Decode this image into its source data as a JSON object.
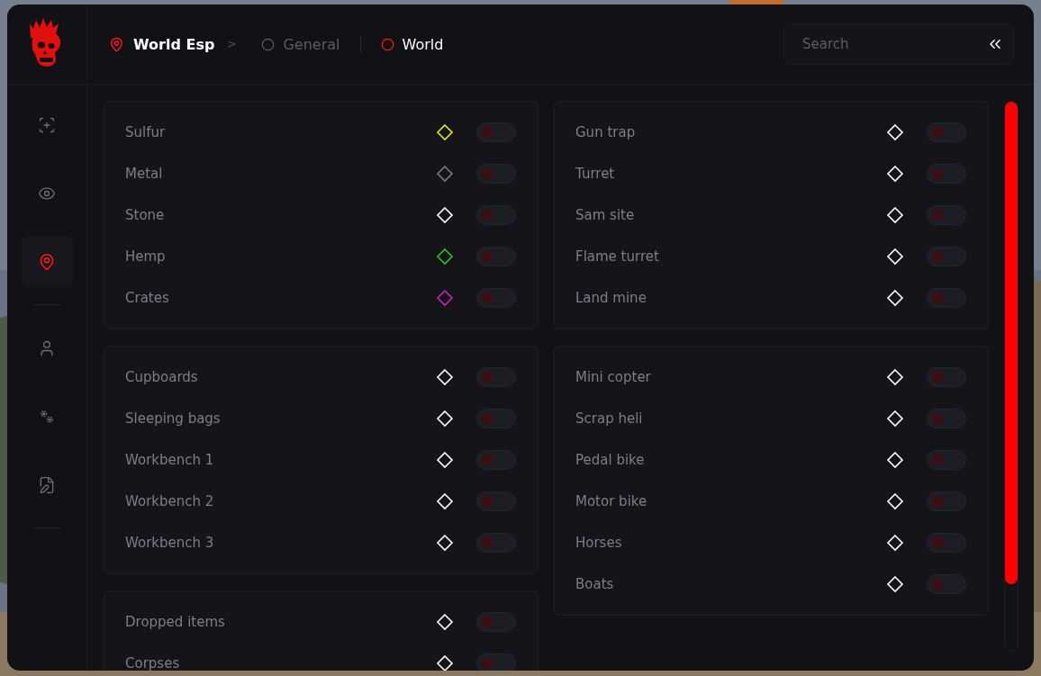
{
  "breadcrumb": {
    "section": "World Esp",
    "separator": ">"
  },
  "tabs": [
    {
      "label": "General",
      "selected": false
    },
    {
      "label": "World",
      "selected": true
    }
  ],
  "search": {
    "placeholder": "Search"
  },
  "sidebar": {
    "items": [
      {
        "selected": false
      },
      {
        "selected": false
      },
      {
        "selected": true
      },
      {
        "selected": false
      },
      {
        "selected": false
      },
      {
        "selected": false
      }
    ]
  },
  "columns": [
    [
      {
        "rows": [
          {
            "label": "Sulfur",
            "color": "#e6e620",
            "on": false
          },
          {
            "label": "Metal",
            "color": "#7a7a7e",
            "on": false
          },
          {
            "label": "Stone",
            "color": "#ffffff",
            "on": false
          },
          {
            "label": "Hemp",
            "color": "#20c820",
            "on": false
          },
          {
            "label": "Crates",
            "color": "#c820c8",
            "on": false
          }
        ]
      },
      {
        "rows": [
          {
            "label": "Cupboards",
            "color": "#ffffff",
            "on": false
          },
          {
            "label": "Sleeping bags",
            "color": "#ffffff",
            "on": false
          },
          {
            "label": "Workbench 1",
            "color": "#ffffff",
            "on": false
          },
          {
            "label": "Workbench 2",
            "color": "#ffffff",
            "on": false
          },
          {
            "label": "Workbench 3",
            "color": "#ffffff",
            "on": false
          }
        ]
      },
      {
        "rows": [
          {
            "label": "Dropped items",
            "color": "#ffffff",
            "on": false
          },
          {
            "label": "Corpses",
            "color": "#ffffff",
            "on": false
          }
        ]
      }
    ],
    [
      {
        "rows": [
          {
            "label": "Gun trap",
            "color": "#ffffff",
            "on": false
          },
          {
            "label": "Turret",
            "color": "#ffffff",
            "on": false
          },
          {
            "label": "Sam site",
            "color": "#ffffff",
            "on": false
          },
          {
            "label": "Flame turret",
            "color": "#ffffff",
            "on": false
          },
          {
            "label": "Land mine",
            "color": "#ffffff",
            "on": false
          }
        ]
      },
      {
        "rows": [
          {
            "label": "Mini copter",
            "color": "#ffffff",
            "on": false
          },
          {
            "label": "Scrap heli",
            "color": "#ffffff",
            "on": false
          },
          {
            "label": "Pedal bike",
            "color": "#ffffff",
            "on": false
          },
          {
            "label": "Motor bike",
            "color": "#ffffff",
            "on": false
          },
          {
            "label": "Horses",
            "color": "#ffffff",
            "on": false
          },
          {
            "label": "Boats",
            "color": "#ffffff",
            "on": false
          }
        ]
      }
    ]
  ]
}
